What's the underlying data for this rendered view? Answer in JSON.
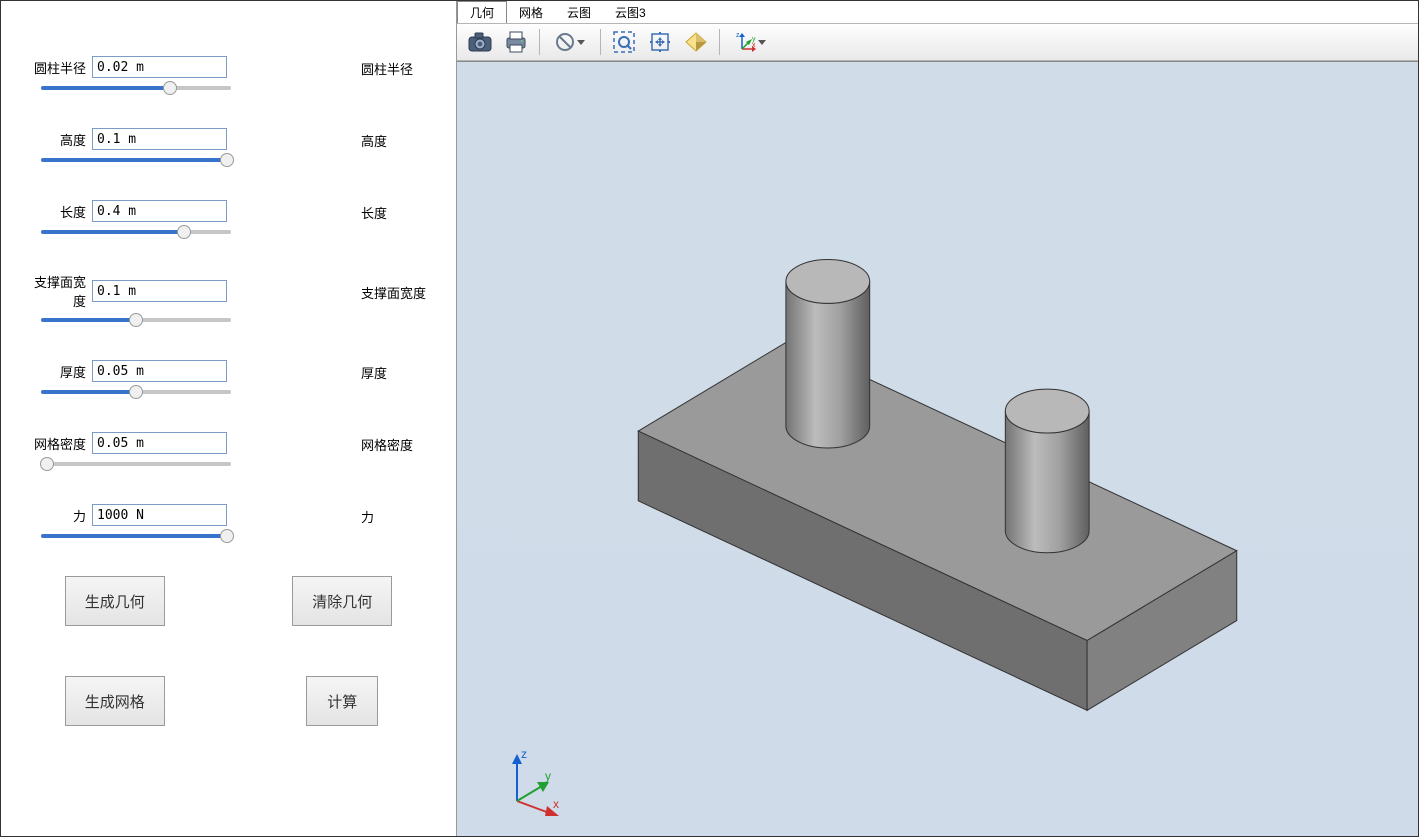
{
  "params": [
    {
      "key": "radius",
      "label": "圆柱半径",
      "rightLabel": "圆柱半径",
      "value": "0.02 m",
      "fillPct": 68
    },
    {
      "key": "height",
      "label": "高度",
      "rightLabel": "高度",
      "value": "0.1 m",
      "fillPct": 98
    },
    {
      "key": "length",
      "label": "长度",
      "rightLabel": "长度",
      "value": "0.4 m",
      "fillPct": 75
    },
    {
      "key": "supportWidth",
      "label": "支撑面宽度",
      "rightLabel": "支撑面宽度",
      "value": "0.1 m",
      "fillPct": 50
    },
    {
      "key": "thickness",
      "label": "厚度",
      "rightLabel": "厚度",
      "value": "0.05 m",
      "fillPct": 50
    },
    {
      "key": "meshDensity",
      "label": "网格密度",
      "rightLabel": "网格密度",
      "value": "0.05 m",
      "fillPct": 3
    },
    {
      "key": "force",
      "label": "力",
      "rightLabel": "力",
      "value": "1000 N",
      "fillPct": 98
    }
  ],
  "buttons": {
    "generateGeometry": "生成几何",
    "clearGeometry": "清除几何",
    "generateMesh": "生成网格",
    "compute": "计算"
  },
  "tabs": [
    "几何",
    "网格",
    "云图",
    "云图3"
  ],
  "activeTab": 0,
  "toolbarIcons": {
    "camera": "camera-icon",
    "print": "print-icon",
    "noselect": "no-select-icon",
    "zoomBox": "zoom-box-icon",
    "zoomExtents": "zoom-extents-icon",
    "rotate": "rotate-view-icon",
    "axes": "axes-orient-icon"
  },
  "axisLabels": {
    "x": "x",
    "y": "y",
    "z": "z"
  }
}
